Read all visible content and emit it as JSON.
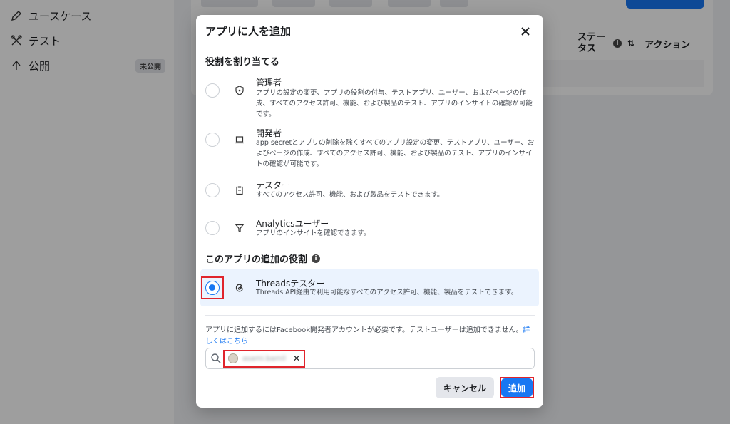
{
  "sidebar": {
    "items": [
      {
        "label": "ユースケース",
        "icon": "pencil-icon"
      },
      {
        "label": "テスト",
        "icon": "tools-icon"
      },
      {
        "label": "公開",
        "icon": "upload-icon",
        "badge": "未公開"
      }
    ]
  },
  "table": {
    "status_header": "ステータス",
    "action_header": "アクション"
  },
  "modal": {
    "title": "アプリに人を追加",
    "assign_roles_title": "役割を割り当てる",
    "roles": [
      {
        "name": "管理者",
        "icon": "shield-icon",
        "description": "アプリの設定の変更、アプリの役割の付与、テストアプリ、ユーザー、およびページの作成、すべてのアクセス許可、機能、および製品のテスト、アプリのインサイトの確認が可能です。"
      },
      {
        "name": "開発者",
        "icon": "laptop-icon",
        "description": "app secretとアプリの削除を除くすべてのアプリ設定の変更、テストアプリ、ユーザー、およびページの作成、すべてのアクセス許可、機能、および製品のテスト、アプリのインサイトの確認が可能です。"
      },
      {
        "name": "テスター",
        "icon": "clipboard-icon",
        "description": "すべてのアクセス許可、機能、および製品をテストできます。"
      },
      {
        "name": "Analyticsユーザー",
        "icon": "filter-icon",
        "description": "アプリのインサイトを確認できます。"
      }
    ],
    "additional_roles_title": "このアプリの追加の役割",
    "threads_role": {
      "name": "Threadsテスター",
      "icon": "threads-icon",
      "description": "Threads API経由で利用可能なすべてのアクセス許可、機能、製品をテストできます。",
      "selected": true
    },
    "notice_text": "アプリに追加するにはFacebook開発者アカウントが必要です。テストユーザーは追加できません。",
    "notice_link": "詳しくはこちら",
    "selected_user": "asami.bamil",
    "cancel_label": "キャンセル",
    "add_label": "追加"
  },
  "colors": {
    "accent": "#1877f2",
    "highlight": "#e0242c"
  }
}
